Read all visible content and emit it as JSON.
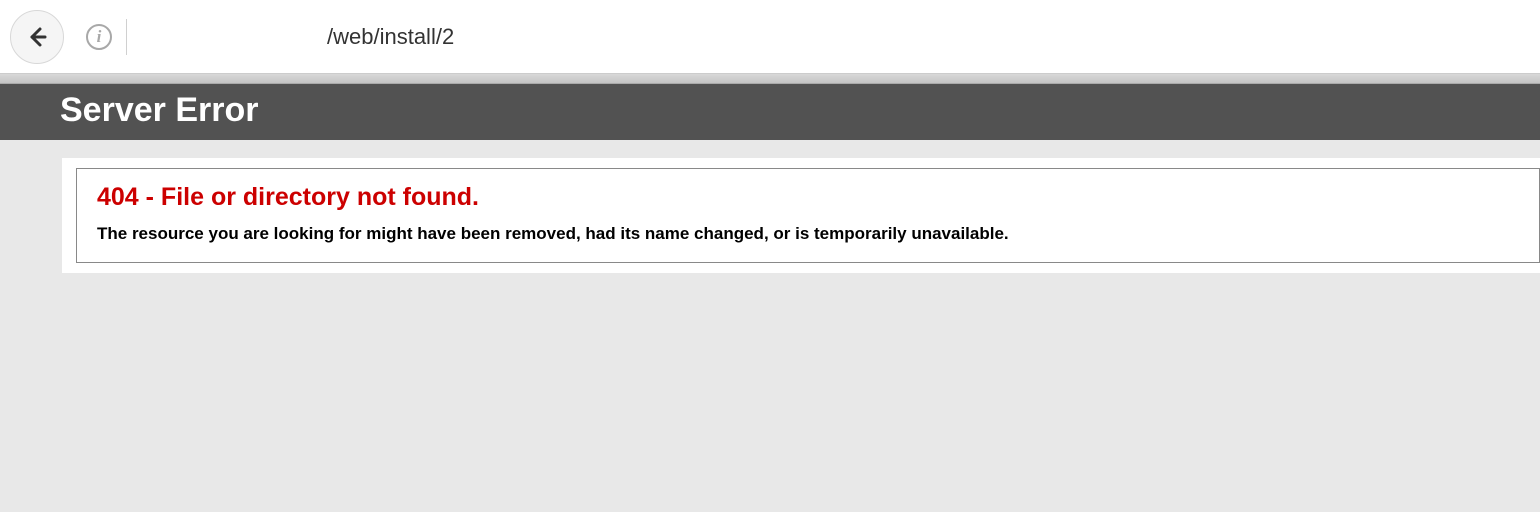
{
  "browser": {
    "url": "/web/install/2",
    "info_glyph": "i"
  },
  "page": {
    "header_title": "Server Error",
    "error_title": "404 - File or directory not found.",
    "error_message": "The resource you are looking for might have been removed, had its name changed, or is temporarily unavailable."
  }
}
